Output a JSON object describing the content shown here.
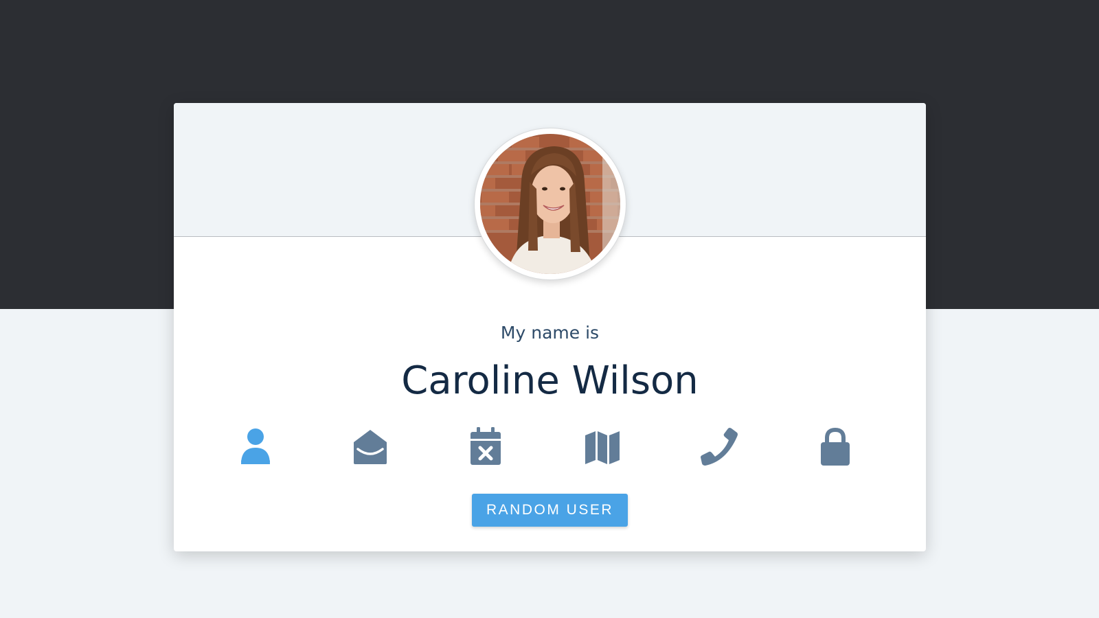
{
  "profile": {
    "intro_label": "My name is",
    "name": "Caroline Wilson"
  },
  "icons": [
    {
      "name": "user-icon",
      "active": true
    },
    {
      "name": "envelope-open-icon",
      "active": false
    },
    {
      "name": "calendar-x-icon",
      "active": false
    },
    {
      "name": "map-icon",
      "active": false
    },
    {
      "name": "phone-icon",
      "active": false
    },
    {
      "name": "lock-icon",
      "active": false
    }
  ],
  "button": {
    "label": "RANDOM USER"
  },
  "colors": {
    "background_dark": "#2c2e33",
    "background_light": "#f0f4f7",
    "accent": "#4aa3e6",
    "icon_inactive": "#627d98",
    "name_text": "#142a44"
  }
}
